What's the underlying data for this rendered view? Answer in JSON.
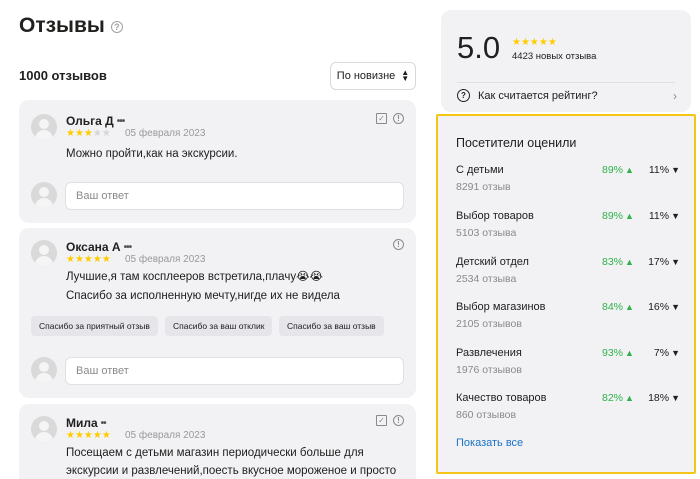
{
  "header": {
    "title": "Отзывы",
    "help_icon": "?"
  },
  "list": {
    "count_label": "1000 отзывов",
    "sort_label": "По новизне"
  },
  "reviews": [
    {
      "author": "Ольга Д",
      "rating": 3,
      "date": "05 февраля 2023",
      "text": "Можно пройти,как на экскурсии.",
      "reply_placeholder": "Ваш ответ"
    },
    {
      "author": "Оксана А",
      "rating": 5,
      "date": "05 февраля 2023",
      "text_line1": "Лучшие,я там косплееров встретила,плачу😭😭",
      "text_line2": "Спасибо за исполненную мечту,нигде их не видела",
      "chips": [
        "Спасибо за приятный отзыв",
        "Спасибо за ваш отклик",
        "Спасибо за ваш отзыв"
      ],
      "reply_placeholder": "Ваш ответ"
    },
    {
      "author": "Мила",
      "rating": 5,
      "date": "05 февраля 2023",
      "text_line1": "Посещаем с детьми магазин периодически больше для",
      "text_line2": "экскурсии и развлечений,поесть вкусное мороженое и просто"
    }
  ],
  "rating": {
    "value": "5.0",
    "stars": 5,
    "count_label": "4423 новых отзыва",
    "help_label": "Как считается рейтинг?"
  },
  "visitors": {
    "title": "Посетители оценили",
    "aspects": [
      {
        "name": "С детьми",
        "count": "8291 отзыв",
        "pos": "89%",
        "neg": "11%"
      },
      {
        "name": "Выбор товаров",
        "count": "5103 отзыва",
        "pos": "89%",
        "neg": "11%"
      },
      {
        "name": "Детский отдел",
        "count": "2534 отзыва",
        "pos": "83%",
        "neg": "17%"
      },
      {
        "name": "Выбор магазинов",
        "count": "2105 отзывов",
        "pos": "84%",
        "neg": "16%"
      },
      {
        "name": "Развлечения",
        "count": "1976 отзывов",
        "pos": "93%",
        "neg": "7%"
      },
      {
        "name": "Качество товаров",
        "count": "860 отзывов",
        "pos": "82%",
        "neg": "18%"
      }
    ],
    "show_all": "Показать все"
  },
  "colors": {
    "star": "#ffcc00",
    "positive": "#2eb24a",
    "highlight_border": "#f5c518",
    "link": "#1a73c7"
  }
}
